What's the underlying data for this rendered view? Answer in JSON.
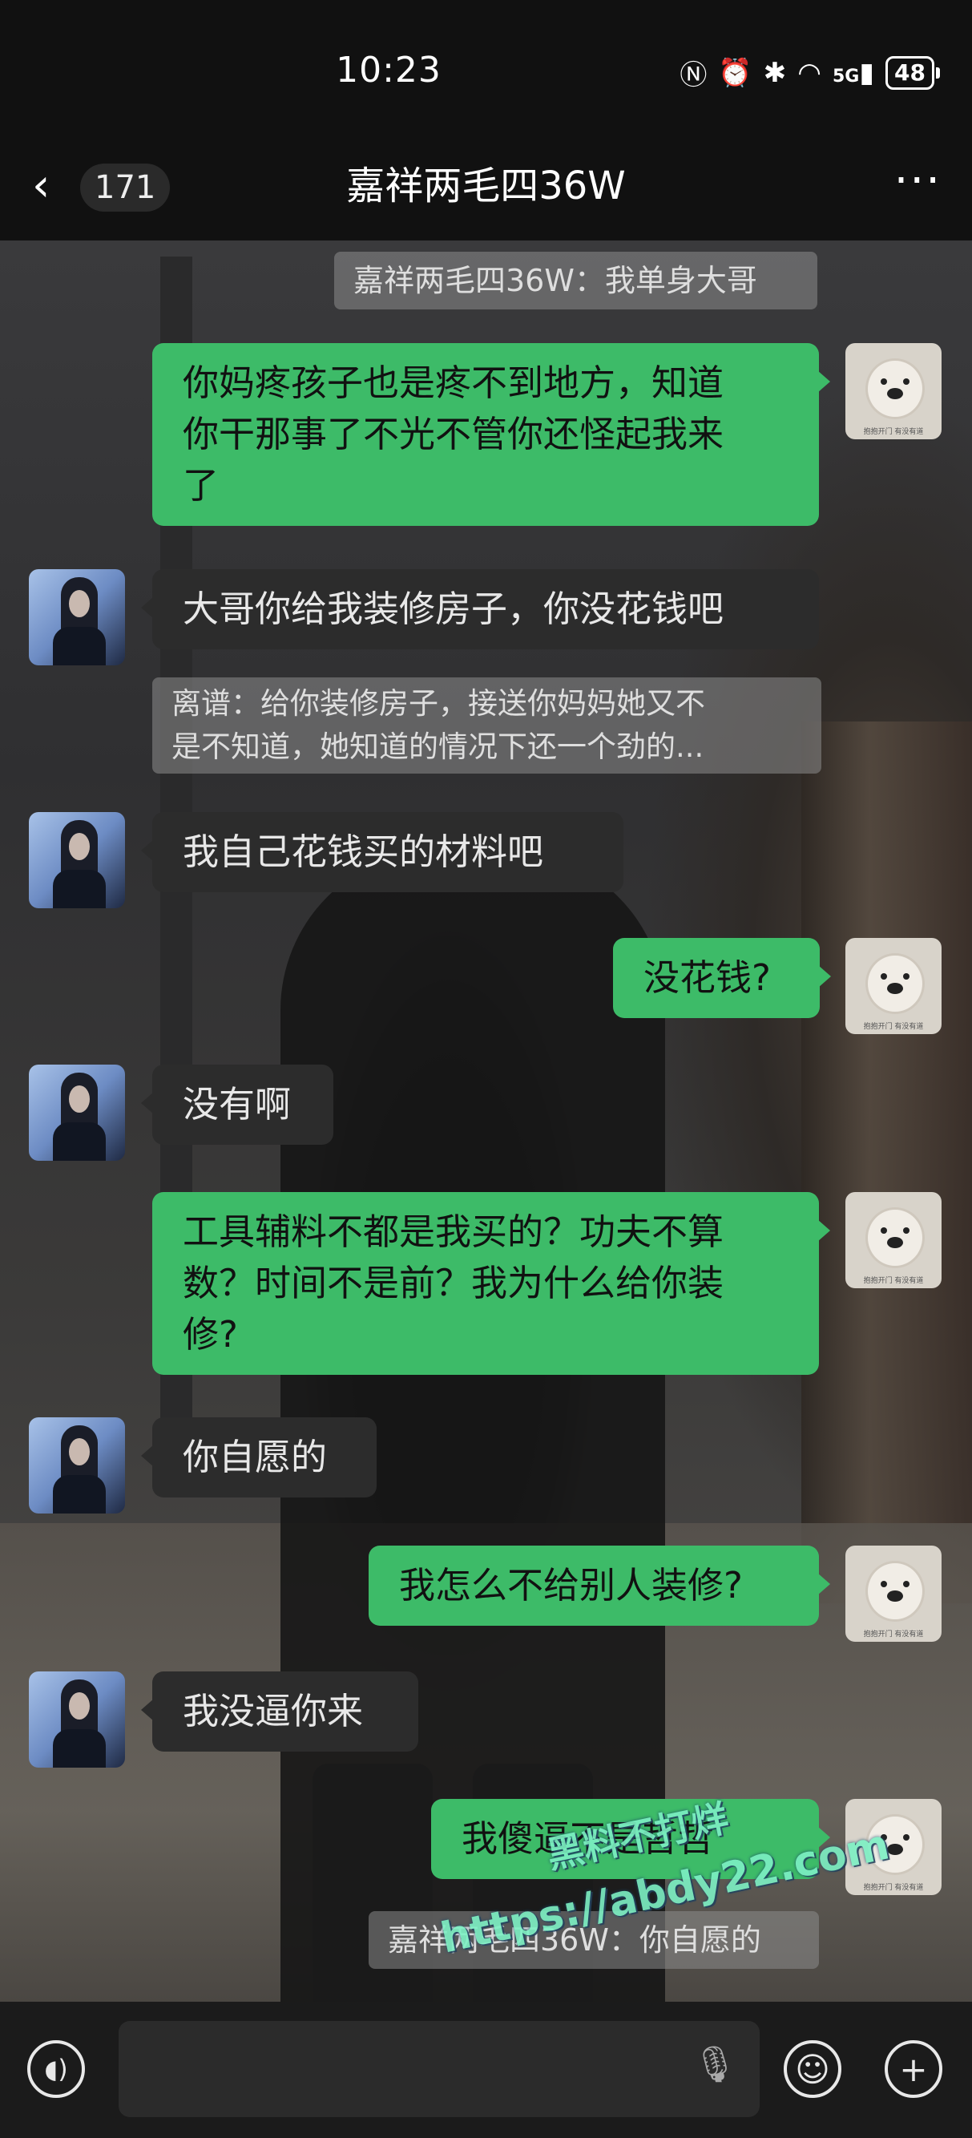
{
  "status": {
    "time": "10:23",
    "icons": [
      "nfc-icon",
      "alarm-icon",
      "bluetooth-icon",
      "wifi-icon",
      "signal-5g-icon"
    ],
    "network_label": "5G",
    "battery": "48"
  },
  "header": {
    "back_label": "‹",
    "unread_count": "171",
    "title": "嘉祥两毛四36W",
    "more_label": "···"
  },
  "messages": [
    {
      "type": "quote",
      "text": "嘉祥两毛四36W：我单身大哥"
    },
    {
      "type": "out",
      "lines": [
        "你妈疼孩子也是疼不到地方，知道",
        "你干那事了不光不管你还怪起我来",
        "了"
      ]
    },
    {
      "type": "in",
      "lines": [
        "大哥你给我装修房子，你没花钱吧"
      ]
    },
    {
      "type": "quote",
      "lines": [
        "离谱：给你装修房子，接送你妈妈她又不",
        "是不知道，她知道的情况下还一个劲的..."
      ]
    },
    {
      "type": "in",
      "lines": [
        "我自己花钱买的材料吧"
      ]
    },
    {
      "type": "out",
      "lines": [
        "没花钱?"
      ]
    },
    {
      "type": "in",
      "lines": [
        "没有啊"
      ]
    },
    {
      "type": "out",
      "lines": [
        "工具辅料不都是我买的？功夫不算",
        "数？时间不是前？我为什么给你装",
        "修?"
      ]
    },
    {
      "type": "in",
      "lines": [
        "你自愿的"
      ]
    },
    {
      "type": "out",
      "lines": [
        "我怎么不给别人装修?"
      ]
    },
    {
      "type": "in",
      "lines": [
        "我没逼你来"
      ]
    },
    {
      "type": "out",
      "lines": [
        "我傻逼不是哲哲"
      ]
    },
    {
      "type": "quote",
      "text": "嘉祥两毛四36W：你自愿的"
    }
  ],
  "avatar_caption": "抱抱开门 有没有道",
  "watermark": {
    "line1": "黑料不打烊",
    "line2": "https://abdy22.com"
  },
  "inputbar": {
    "voice_icon": "voice-icon",
    "mic_icon": "mic-icon",
    "emoji_icon": "emoji-icon",
    "plus_icon": "plus-icon"
  },
  "colors": {
    "outgoing_bubble": "#3dbb68",
    "incoming_bubble": "#2c2c2c",
    "background": "#111111"
  }
}
